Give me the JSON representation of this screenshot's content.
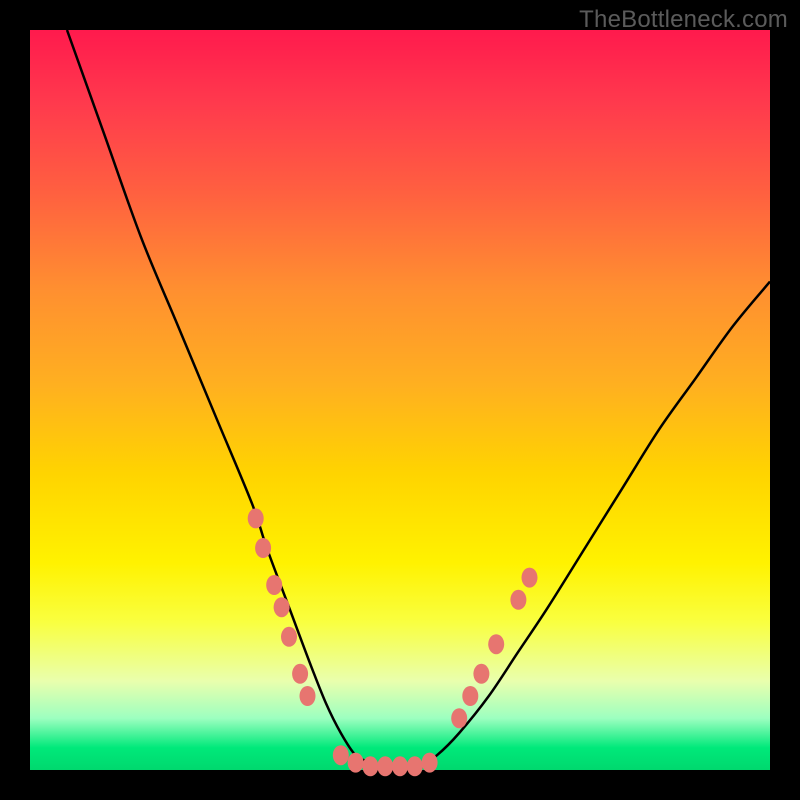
{
  "watermark": "TheBottleneck.com",
  "chart_data": {
    "type": "line",
    "title": "",
    "xlabel": "",
    "ylabel": "",
    "xlim": [
      0,
      100
    ],
    "ylim": [
      0,
      100
    ],
    "series": [
      {
        "name": "bottleneck-curve",
        "x": [
          5,
          10,
          15,
          20,
          25,
          30,
          32,
          35,
          38,
          40,
          42,
          44,
          46,
          48,
          50,
          52,
          55,
          58,
          62,
          66,
          70,
          75,
          80,
          85,
          90,
          95,
          100
        ],
        "values": [
          100,
          86,
          72,
          60,
          48,
          36,
          30,
          22,
          14,
          9,
          5,
          2,
          1,
          0,
          0,
          0,
          2,
          5,
          10,
          16,
          22,
          30,
          38,
          46,
          53,
          60,
          66
        ]
      }
    ],
    "markers": [
      {
        "x": 30.5,
        "y": 34
      },
      {
        "x": 31.5,
        "y": 30
      },
      {
        "x": 33,
        "y": 25
      },
      {
        "x": 34,
        "y": 22
      },
      {
        "x": 35,
        "y": 18
      },
      {
        "x": 36.5,
        "y": 13
      },
      {
        "x": 37.5,
        "y": 10
      },
      {
        "x": 42,
        "y": 2
      },
      {
        "x": 44,
        "y": 1
      },
      {
        "x": 46,
        "y": 0.5
      },
      {
        "x": 48,
        "y": 0.5
      },
      {
        "x": 50,
        "y": 0.5
      },
      {
        "x": 52,
        "y": 0.5
      },
      {
        "x": 54,
        "y": 1
      },
      {
        "x": 58,
        "y": 7
      },
      {
        "x": 59.5,
        "y": 10
      },
      {
        "x": 61,
        "y": 13
      },
      {
        "x": 63,
        "y": 17
      },
      {
        "x": 66,
        "y": 23
      },
      {
        "x": 67.5,
        "y": 26
      }
    ],
    "gradient_stops": [
      {
        "pos": 0,
        "color": "#ff1a4d"
      },
      {
        "pos": 60,
        "color": "#ffd400"
      },
      {
        "pos": 100,
        "color": "#00d86e"
      }
    ]
  }
}
